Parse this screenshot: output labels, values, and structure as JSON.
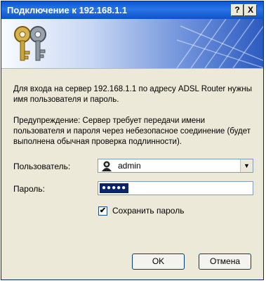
{
  "window": {
    "title": "Подключение к 192.168.1.1",
    "help_label": "?",
    "close_label": "X"
  },
  "message": {
    "intro": "Для входа на сервер 192.168.1.1 по адресу ADSL Router нужны имя пользователя и пароль.",
    "warning": "Предупреждение: Сервер требует передачи имени пользователя и пароля через небезопасное соединение (будет выполнена обычная проверка подлинности)."
  },
  "form": {
    "user_label": "Пользователь:",
    "user_value": "admin",
    "password_label": "Пароль:",
    "password_value": "●●●●●",
    "remember_label": "Сохранить пароль",
    "remember_checked": true
  },
  "buttons": {
    "ok": "OK",
    "cancel": "Отмена"
  }
}
